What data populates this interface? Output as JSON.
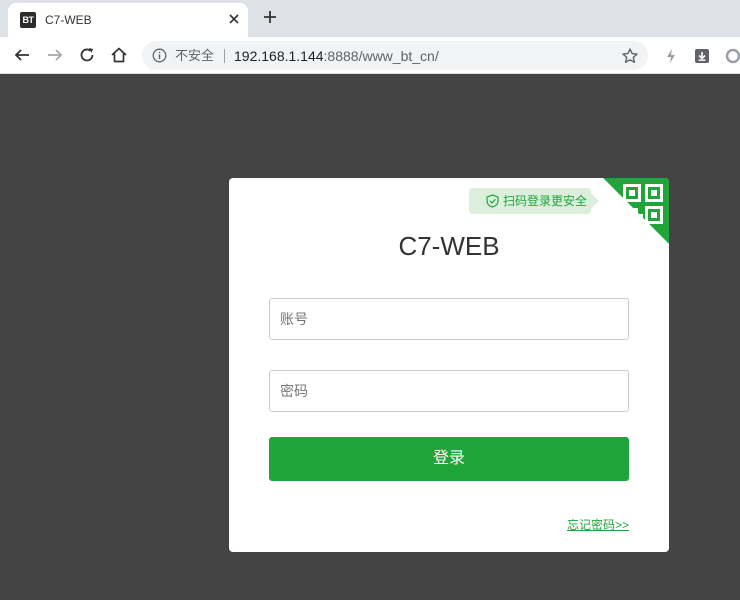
{
  "browser": {
    "tab": {
      "favicon_text": "BT",
      "title": "C7-WEB",
      "close_glyph": "✕"
    },
    "new_tab_glyph": "+",
    "address": {
      "security_label": "不安全",
      "host": "192.168.1.144",
      "rest": ":8888/www_bt_cn/"
    },
    "icons": [
      "back-arrow-icon",
      "forward-arrow-icon",
      "reload-icon",
      "home-icon",
      "info-icon",
      "star-icon",
      "bolt-icon",
      "download-icon",
      "extension-icon"
    ]
  },
  "login": {
    "scan_tip": "扫码登录更安全",
    "title": "C7-WEB",
    "username_placeholder": "账号",
    "password_placeholder": "密码",
    "login_button": "登录",
    "forgot_link": "忘记密码>>"
  },
  "colors": {
    "accent": "#20a53a",
    "page_background": "#444444",
    "tip_background": "#dcefdc"
  }
}
